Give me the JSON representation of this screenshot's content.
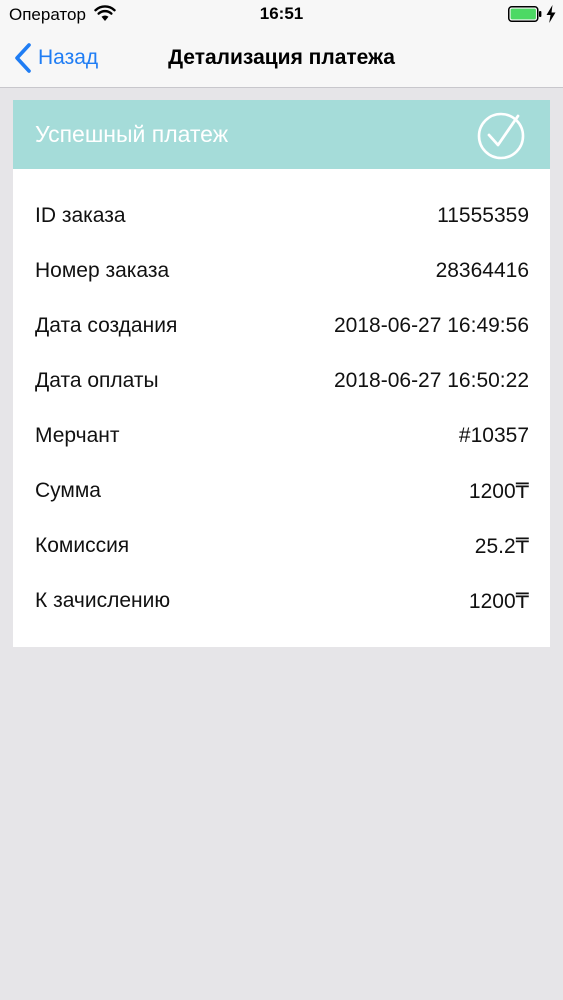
{
  "status_bar": {
    "carrier": "Оператор",
    "time": "16:51"
  },
  "nav": {
    "back_label": "Назад",
    "title": "Детализация платежа"
  },
  "payment": {
    "status_title": "Успешный платеж",
    "rows": [
      {
        "label": "ID заказа",
        "value": "11555359"
      },
      {
        "label": "Номер заказа",
        "value": "28364416"
      },
      {
        "label": "Дата создания",
        "value": "2018-06-27 16:49:56"
      },
      {
        "label": "Дата оплаты",
        "value": "2018-06-27 16:50:22"
      },
      {
        "label": "Мерчант",
        "value": "#10357"
      },
      {
        "label": "Сумма",
        "value": "1200₸"
      },
      {
        "label": "Комиссия",
        "value": "25.2₸"
      },
      {
        "label": "К зачислению",
        "value": "1200₸"
      }
    ]
  },
  "colors": {
    "accent": "#1f7df4",
    "header_bg": "#a5dcd9",
    "background": "#e6e5e8",
    "battery": "#4cd964"
  }
}
